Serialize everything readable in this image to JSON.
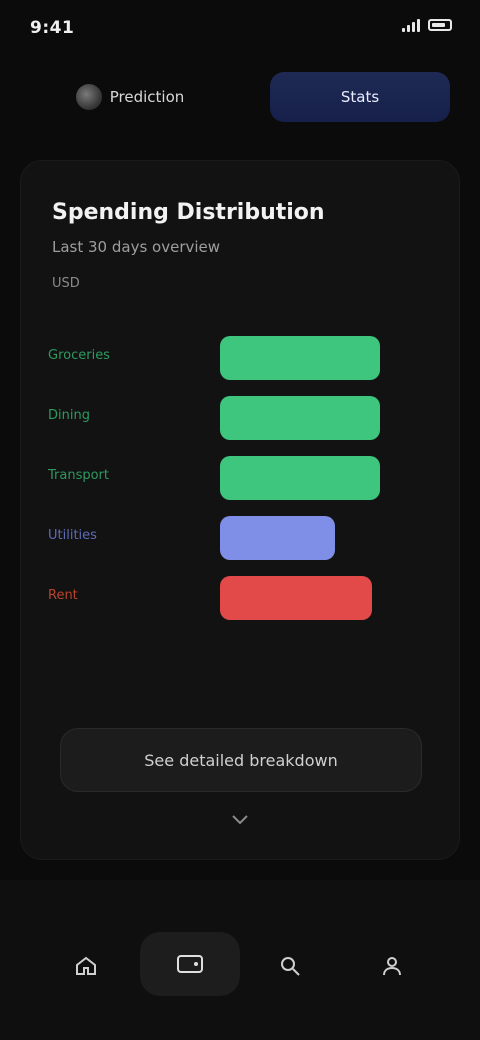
{
  "status": {
    "time": "9:41"
  },
  "top_nav": {
    "left_tab": "Prediction",
    "right_tab": "Stats"
  },
  "card": {
    "title": "Spending Distribution",
    "subtitle": "Last 30 days overview",
    "meta": "USD",
    "cta_label": "See detailed breakdown"
  },
  "bars": [
    {
      "label": "Groceries",
      "color": "#3ec57e",
      "fraction": 1.0
    },
    {
      "label": "Dining",
      "color": "#3ec57e",
      "fraction": 1.0
    },
    {
      "label": "Transport",
      "color": "#3ec57e",
      "fraction": 1.0
    },
    {
      "label": "Utilities",
      "color": "#7f8ee6",
      "fraction": 0.72
    },
    {
      "label": "Rent",
      "color": "#e24a4a",
      "fraction": 0.95
    }
  ],
  "label_colors": [
    "#2e9a60",
    "#2e9a60",
    "#2e9a60",
    "#5f6bb7",
    "#b8442c"
  ],
  "icons": {
    "nav_home": "home-icon",
    "nav_center": "wallet-icon",
    "nav_search": "search-icon",
    "nav_profile": "profile-icon"
  }
}
